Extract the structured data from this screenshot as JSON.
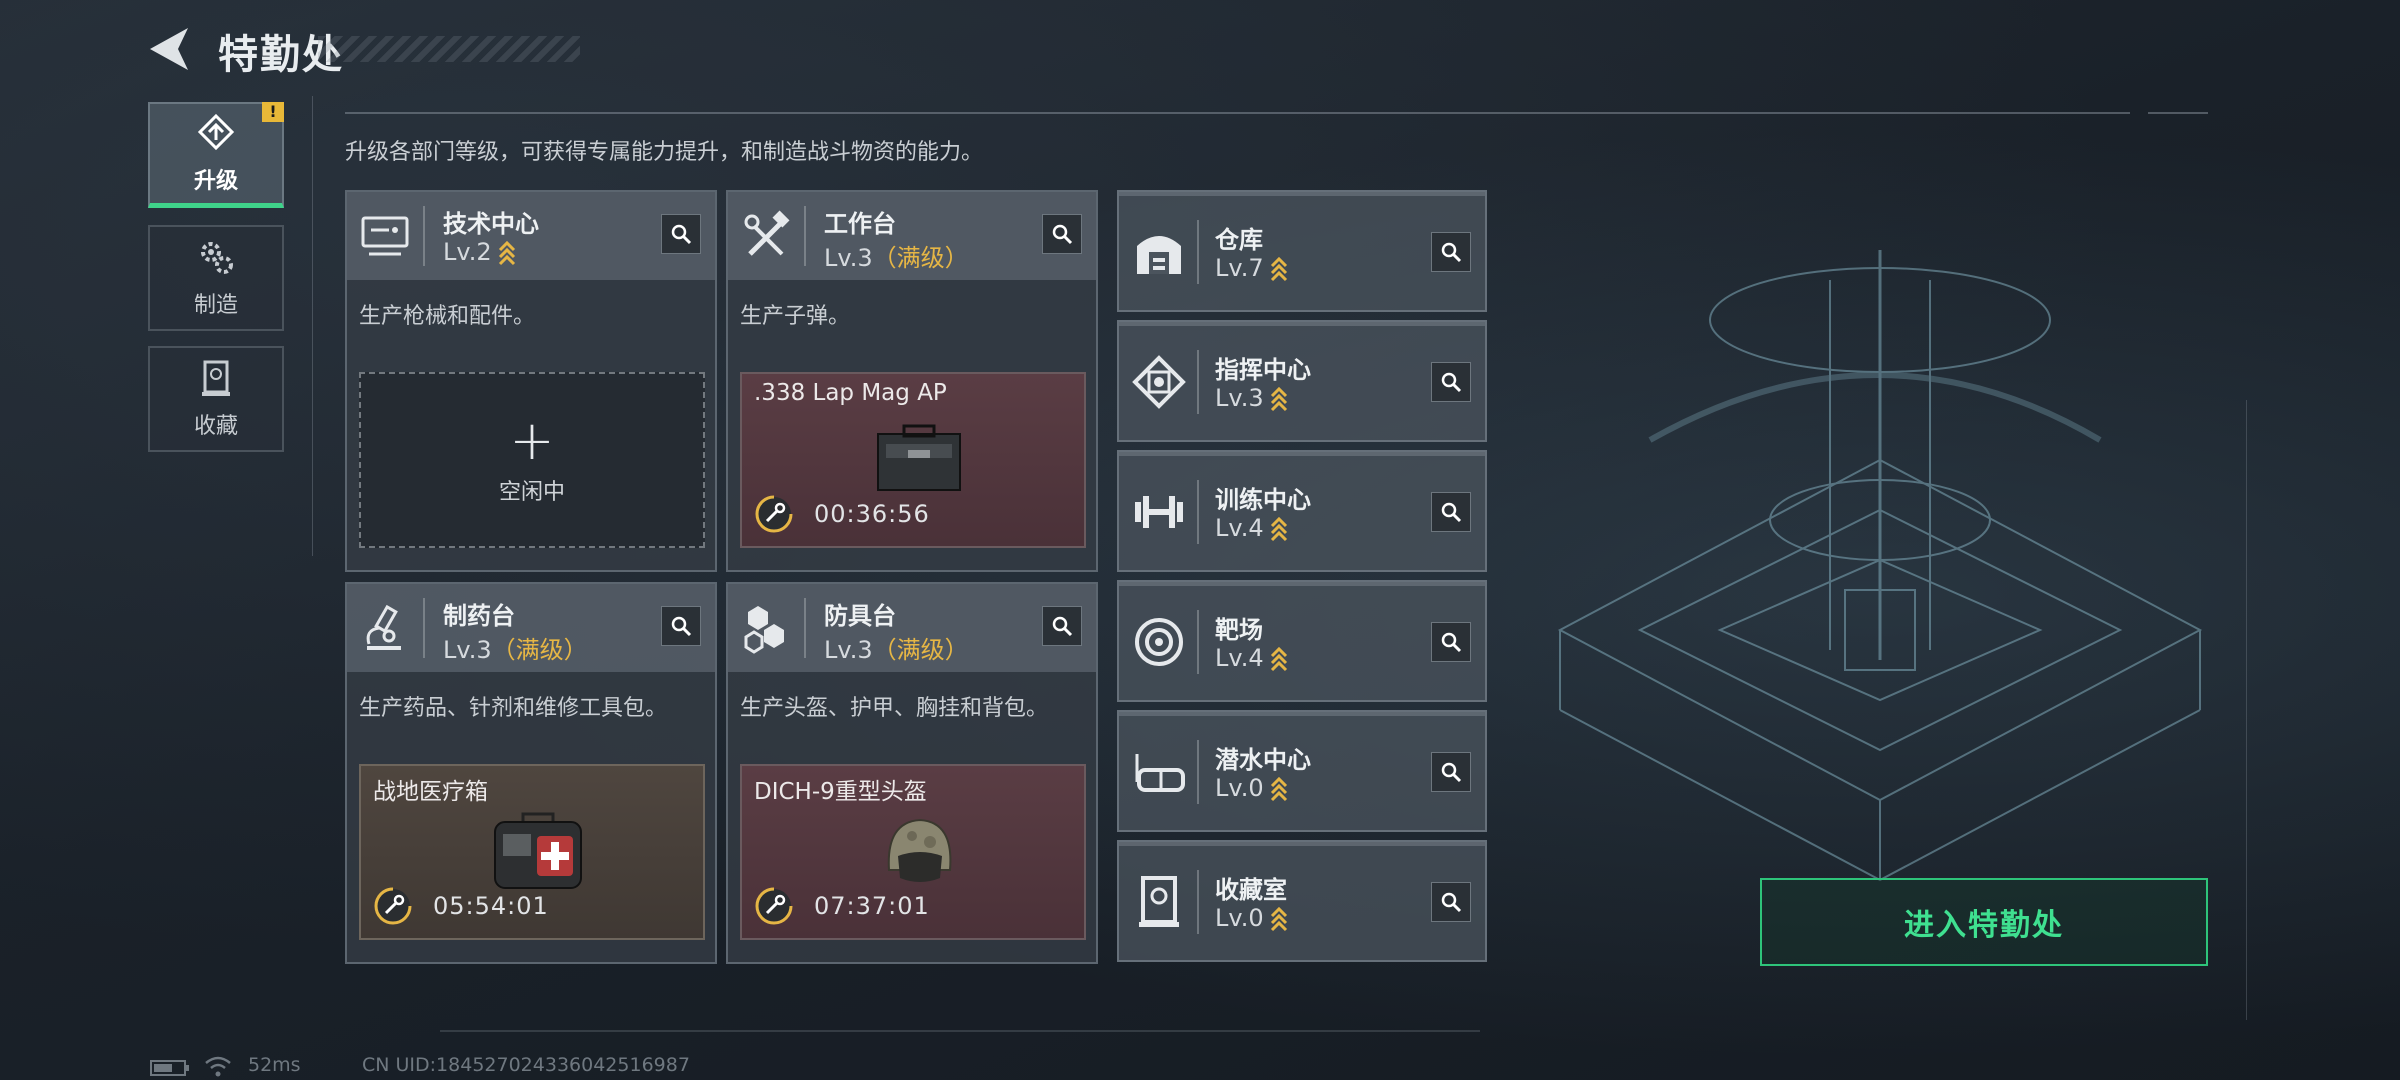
{
  "header": {
    "title": "特勤处"
  },
  "nav": [
    {
      "label": "升级",
      "icon": "upgrade-icon",
      "active": true,
      "alert": "!"
    },
    {
      "label": "制造",
      "icon": "gears-icon",
      "active": false
    },
    {
      "label": "收藏",
      "icon": "collection-icon",
      "active": false
    }
  ],
  "intro": "升级各部门等级，可获得专属能力提升，和制造战斗物资的能力。",
  "cards": [
    {
      "name": "技术中心",
      "level": "Lv.2",
      "max_tag": "",
      "desc": "生产枪械和配件。",
      "slot_idle": "空闲中",
      "icon": "computer-icon"
    },
    {
      "name": "工作台",
      "level": "Lv.3",
      "max_tag": "（满级）",
      "desc": "生产子弹。",
      "slot_item": ".338 Lap Mag AP",
      "slot_time": "00:36:56",
      "icon": "tools-icon"
    },
    {
      "name": "制药台",
      "level": "Lv.3",
      "max_tag": "（满级）",
      "desc": "生产药品、针剂和维修工具包。",
      "slot_item": "战地医疗箱",
      "slot_time": "05:54:01",
      "icon": "microscope-icon"
    },
    {
      "name": "防具台",
      "level": "Lv.3",
      "max_tag": "（满级）",
      "desc": "生产头盔、护甲、胸挂和背包。",
      "slot_item": "DICH-9重型头盔",
      "slot_time": "07:37:01",
      "icon": "armor-icon"
    }
  ],
  "minis": [
    {
      "name": "仓库",
      "level": "Lv.7",
      "icon": "warehouse-icon"
    },
    {
      "name": "指挥中心",
      "level": "Lv.3",
      "icon": "command-icon"
    },
    {
      "name": "训练中心",
      "level": "Lv.4",
      "icon": "dumbbell-icon"
    },
    {
      "name": "靶场",
      "level": "Lv.4",
      "icon": "target-icon"
    },
    {
      "name": "潜水中心",
      "level": "Lv.0",
      "icon": "diving-mask-icon"
    },
    {
      "name": "收藏室",
      "level": "Lv.0",
      "icon": "trophy-room-icon"
    }
  ],
  "enter_button": "进入特勤处",
  "status": {
    "ping": "52ms",
    "uid": "CN UID:18452702433604251698​7"
  },
  "colors": {
    "accent_green": "#3fe090",
    "max_level_gold": "#e6b645",
    "alert_yellow": "#e8b838"
  }
}
